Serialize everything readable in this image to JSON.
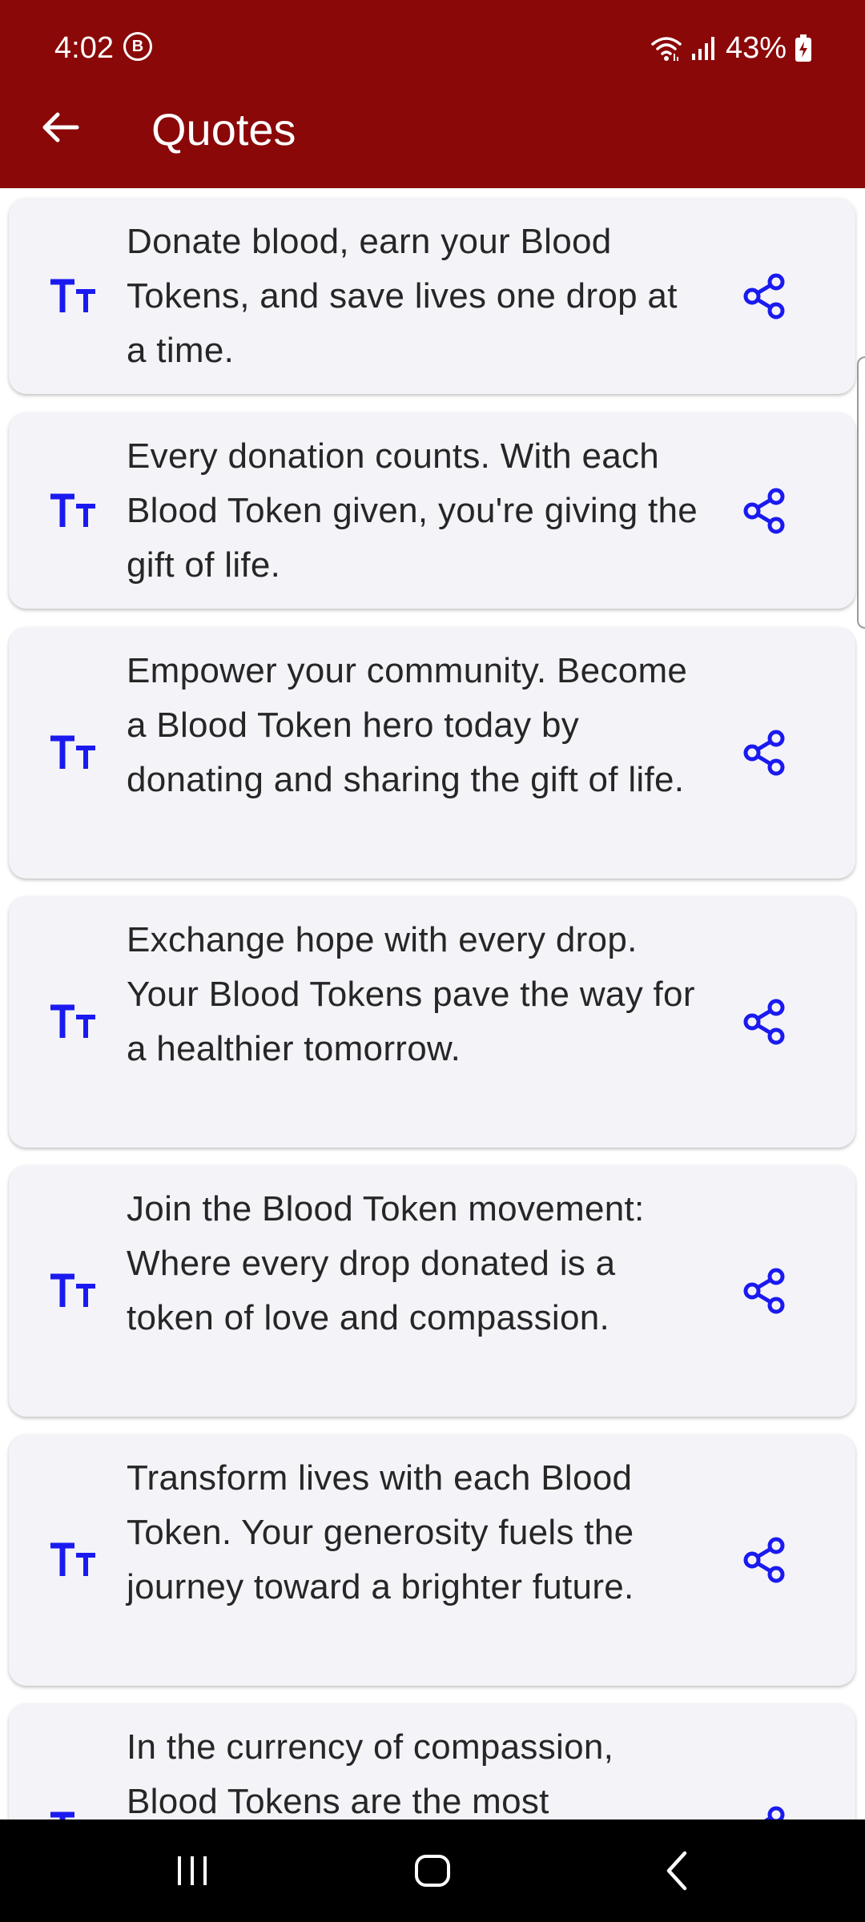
{
  "status_bar": {
    "time": "4:02",
    "badge": "B",
    "battery": "43%"
  },
  "app_bar": {
    "title": "Quotes",
    "back_icon": "arrow-left-icon",
    "background": "#8a0808"
  },
  "accent_color": "#1a1af0",
  "quotes": [
    {
      "text": "Donate blood, earn your Blood Tokens, and save lives one drop at a time."
    },
    {
      "text": "Every donation counts. With each Blood Token given, you're giving the gift of life."
    },
    {
      "text": "Empower your community. Become a Blood Token hero today by donating and sharing the gift of life."
    },
    {
      "text": "Exchange hope with every drop. Your Blood Tokens pave the way for a healthier tomorrow."
    },
    {
      "text": "Join the Blood Token movement: Where every drop donated is a token of love and compassion."
    },
    {
      "text": "Transform lives with each Blood Token. Your generosity fuels the journey toward a brighter future."
    },
    {
      "text": "In the currency of compassion, Blood Tokens are the most"
    }
  ],
  "icons": {
    "text_style": "text-size-icon",
    "share": "share-icon"
  },
  "nav_bar": {
    "recents": "recent-apps-icon",
    "home": "home-icon",
    "back": "back-icon"
  }
}
